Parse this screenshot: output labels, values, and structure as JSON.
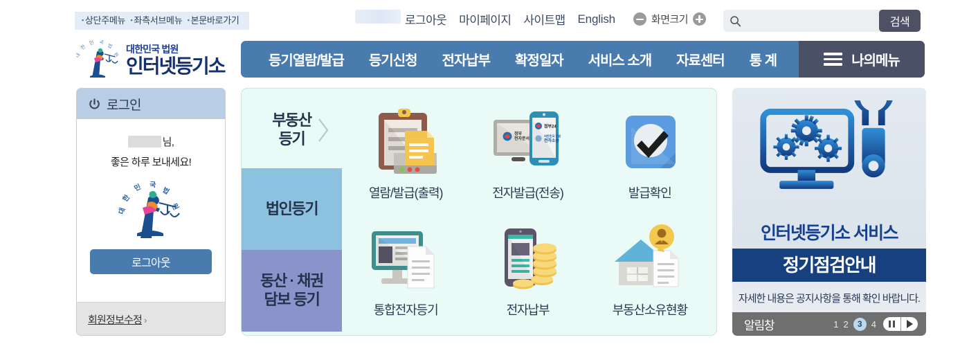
{
  "skip_nav": {
    "items": [
      "상단주메뉴",
      "좌측서브메뉴",
      "본문바로가기"
    ]
  },
  "util_menu": {
    "logout": "로그아웃",
    "mypage": "마이페이지",
    "sitemap": "사이트맵",
    "english": "English",
    "screen_size_label": "화면크기",
    "zoom_out_icon": "minus-circle-icon",
    "zoom_in_icon": "plus-circle-icon"
  },
  "search": {
    "icon": "search-icon",
    "value": "",
    "placeholder": "",
    "button_label": "검색"
  },
  "logo": {
    "icon": "justice-goddess-emblem-icon",
    "line1": "대한민국 법원",
    "line2": "인터넷등기소"
  },
  "nav": {
    "items": [
      "등기열람/발급",
      "등기신청",
      "전자납부",
      "확정일자",
      "서비스 소개",
      "자료센터",
      "통 계"
    ],
    "mymenu_label": "나의메뉴",
    "mymenu_icon": "hamburger-icon",
    "bg_color": "#4a7bae",
    "mymenu_bg_color": "#4a5166"
  },
  "login_panel": {
    "header_label": "로그인",
    "header_icon": "power-icon",
    "greeting_suffix": "님,",
    "greeting_line2": "좋은 하루 보내세요!",
    "emblem_icon": "justice-goddess-emblem-icon",
    "logout_button": "로그아웃",
    "member_edit_link": "회원정보수정",
    "member_edit_chevron": "›"
  },
  "service_panel": {
    "tabs": [
      {
        "label": "부동산\n등기",
        "active": true,
        "color": "#eafaf6"
      },
      {
        "label": "법인등기",
        "active": false,
        "color": "#8cc2e0"
      },
      {
        "label": "동산 · 채권\n담보 등기",
        "active": false,
        "color": "#8b93cb"
      }
    ],
    "tab_arrow_icon": "chevron-right-icon",
    "services": [
      {
        "label": "열람/발급(출력)",
        "icon": "clipboard-document-icon"
      },
      {
        "label": "전자발급(전송)",
        "icon": "monitor-mobile-icon"
      },
      {
        "label": "발급확인",
        "icon": "check-badge-icon"
      },
      {
        "label": "통합전자등기",
        "icon": "desktop-document-icon"
      },
      {
        "label": "전자납부",
        "icon": "mobile-coins-icon"
      },
      {
        "label": "부동산소유현황",
        "icon": "house-person-document-icon"
      }
    ],
    "bg_color": "#eafaf6"
  },
  "banner": {
    "art_icon": "monitor-gears-wrench-icon",
    "title1": "인터넷등기소 서비스",
    "title2": "정기점검안내",
    "subtitle": "자세한 내용은 공지사항을 통해 확인 바랍니다.",
    "bar_label": "알림창",
    "pages": [
      "1",
      "2",
      "3",
      "4"
    ],
    "active_page": "3",
    "pause_icon": "pause-icon",
    "next_icon": "next-icon",
    "title2_bg_color": "#16417e"
  }
}
